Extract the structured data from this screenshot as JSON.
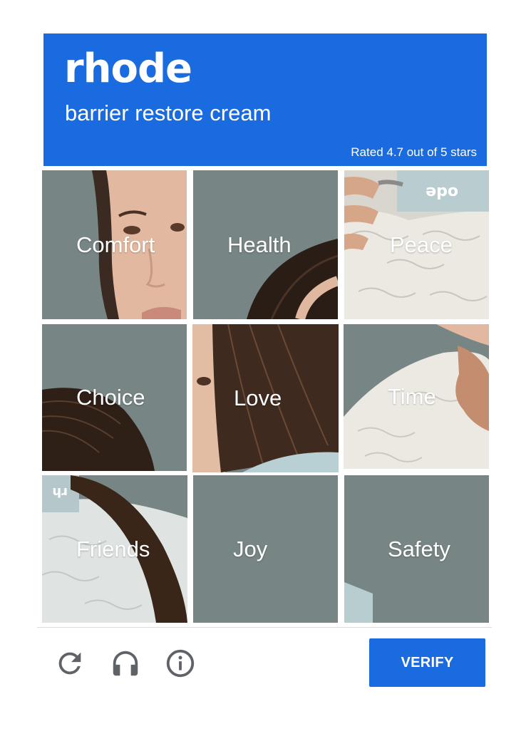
{
  "header": {
    "brand": "rhode",
    "product": "barrier restore cream",
    "rating_text": "Rated 4.7 out of 5 stars",
    "background_color": "#1a6bdf"
  },
  "tiles": [
    {
      "label": "Comfort",
      "image": "face-closeup"
    },
    {
      "label": "Health",
      "image": "hair-part"
    },
    {
      "label": "Peace",
      "image": "hand-with-tube-on-knit"
    },
    {
      "label": "Choice",
      "image": "hair-strands"
    },
    {
      "label": "Love",
      "image": "face-with-hair-and-tube"
    },
    {
      "label": "Time",
      "image": "chin-and-hand-on-knit"
    },
    {
      "label": "Friends",
      "image": "tube-and-hair-on-knit"
    },
    {
      "label": "Joy",
      "image": "plain"
    },
    {
      "label": "Safety",
      "image": "tube-edge"
    }
  ],
  "tile_background_color": "#778584",
  "footer": {
    "reload_icon": "reload-icon",
    "audio_icon": "headphones-icon",
    "info_icon": "info-icon",
    "verify_label": "VERIFY",
    "verify_color": "#1a6bdf",
    "icon_color": "#5f6368"
  }
}
